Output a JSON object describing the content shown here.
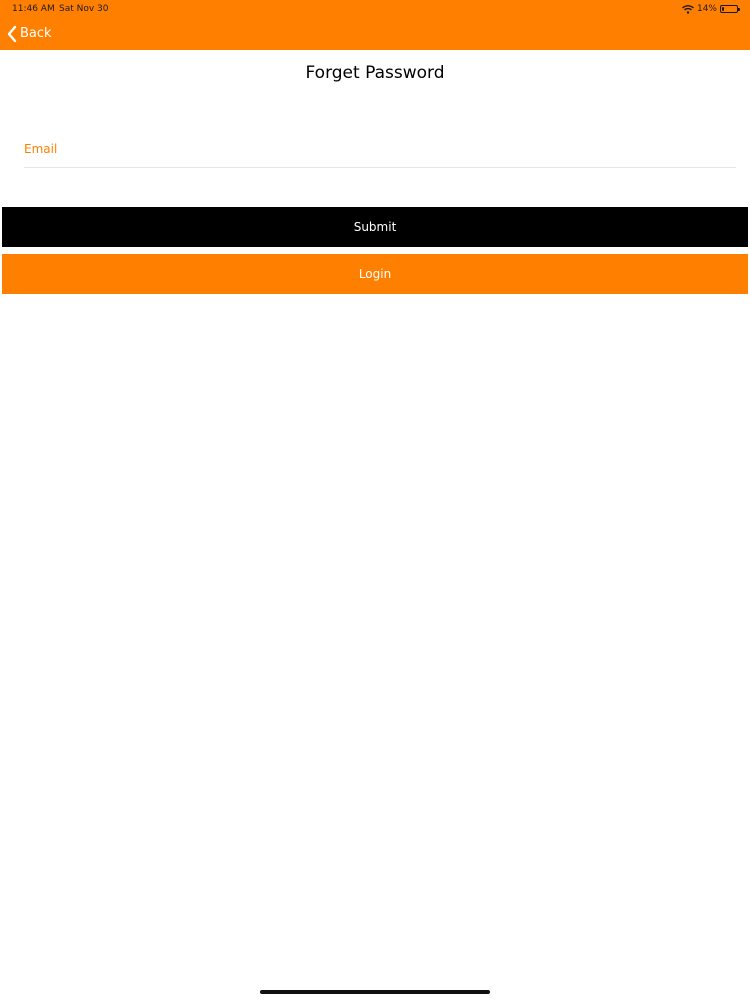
{
  "status_bar": {
    "time": "11:46 AM",
    "date": "Sat Nov 30",
    "battery_percent_label": "14%",
    "battery_level": 0.14,
    "icons": [
      "wifi-icon",
      "battery-icon"
    ]
  },
  "nav": {
    "back_label": "Back",
    "back_icon": "chevron-left-icon"
  },
  "page": {
    "title": "Forget Password"
  },
  "form": {
    "email_placeholder": "Email",
    "email_value": "",
    "submit_label": "Submit",
    "login_label": "Login"
  },
  "colors": {
    "brand_orange": "#ff8000",
    "submit_black": "#000000",
    "background": "#ffffff"
  }
}
